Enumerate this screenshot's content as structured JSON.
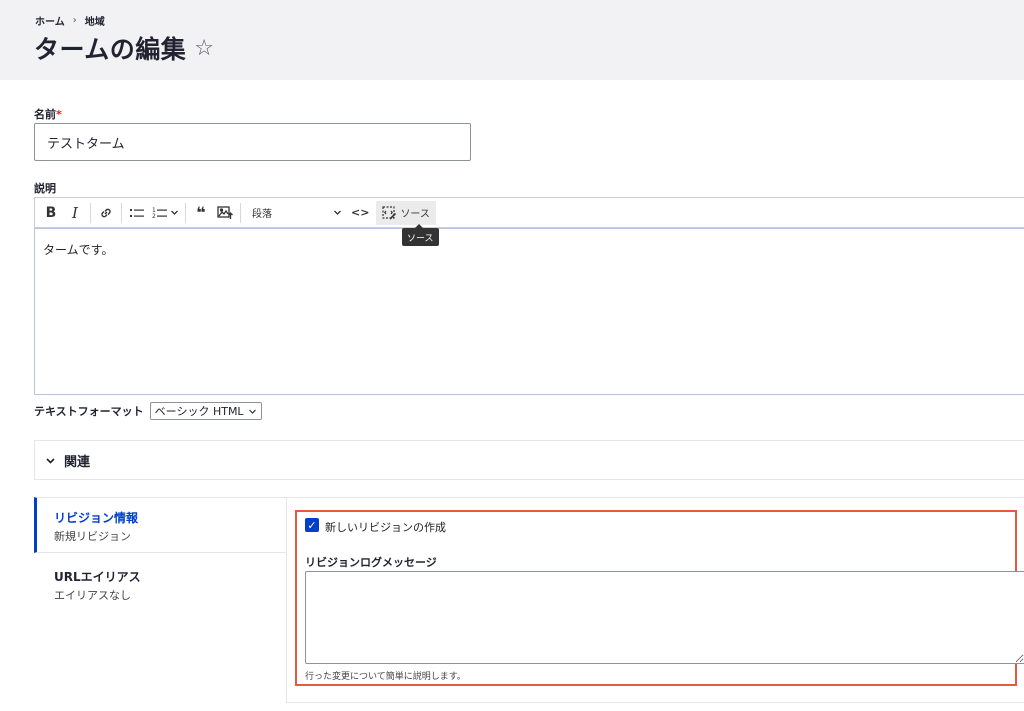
{
  "breadcrumb": {
    "home": "ホーム",
    "separator": "›",
    "region": "地域"
  },
  "page": {
    "title": "タームの編集",
    "star": "☆"
  },
  "name_field": {
    "label": "名前",
    "required_mark": "*",
    "value": "テストターム"
  },
  "description_field": {
    "label": "説明",
    "content": "タームです。"
  },
  "toolbar": {
    "bold": "B",
    "italic": "I",
    "link_icon": "link-icon",
    "bullet_list_icon": "bulleted-list-icon",
    "numbered_list_icon": "numbered-list-icon",
    "blockquote": "❝",
    "image_icon": "image-upload-icon",
    "paragraph": "段落",
    "code": "<>",
    "source": "ソース",
    "tooltip": "ソース"
  },
  "text_format": {
    "label": "テキストフォーマット",
    "selected": "ベーシック HTML"
  },
  "related": {
    "label": "関連"
  },
  "vertical_tabs": [
    {
      "title": "リビジョン情報",
      "summary": "新規リビジョン"
    },
    {
      "title": "URLエイリアス",
      "summary": "エイリアスなし"
    }
  ],
  "revision": {
    "checkbox_label": "新しいリビジョンの作成",
    "checked": true,
    "log_label": "リビジョンログメッセージ",
    "log_value": "",
    "help": "行った変更について簡単に説明します。"
  },
  "colors": {
    "accent": "#003ecc",
    "highlight": "#e55a3c",
    "required": "#d72222"
  }
}
